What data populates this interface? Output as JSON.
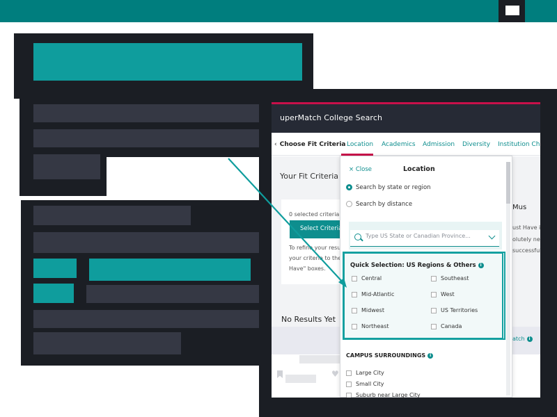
{
  "colors": {
    "teal": "#007e7e",
    "teal_bright": "#0f9d9d",
    "dark": "#1b1e24",
    "bar": "#353844",
    "accent_red": "#c8104a"
  },
  "app": {
    "title": "uperMatch College Search"
  },
  "tabs": {
    "choose": "Choose Fit Criteria",
    "items": [
      "Location",
      "Academics",
      "Admission",
      "Diversity",
      "Institution Chara"
    ]
  },
  "main": {
    "fit_title": "Your Fit Criteria",
    "selected_count": "0 selected criteria",
    "select_button": "Select Criteria T",
    "refine_lines": [
      "To refine your result",
      "your criteria to the",
      "Have\" boxes."
    ],
    "no_results": "No Results Yet",
    "right_heading": "Mus",
    "right_lines": [
      "ust Have is",
      "olutely nee",
      "successful"
    ],
    "match_label": "atch"
  },
  "location_panel": {
    "close_label": "Close",
    "title": "Location",
    "search_mode_state": "Search by state or region",
    "search_mode_distance": "Search by distance",
    "search_placeholder": "Type US State or Canadian Province...",
    "quick_title": "Quick Selection: US Regions & Others",
    "regions_left": [
      "Central",
      "Mid-Atlantic",
      "Midwest",
      "Northeast"
    ],
    "regions_right": [
      "Southeast",
      "West",
      "US Territories",
      "Canada"
    ],
    "campus_title": "CAMPUS SURROUNDINGS",
    "campus_options": [
      "Large City",
      "Small City",
      "Suburb near Large City"
    ]
  },
  "icons": {
    "close": "×",
    "info": "i",
    "heart": "♥"
  }
}
